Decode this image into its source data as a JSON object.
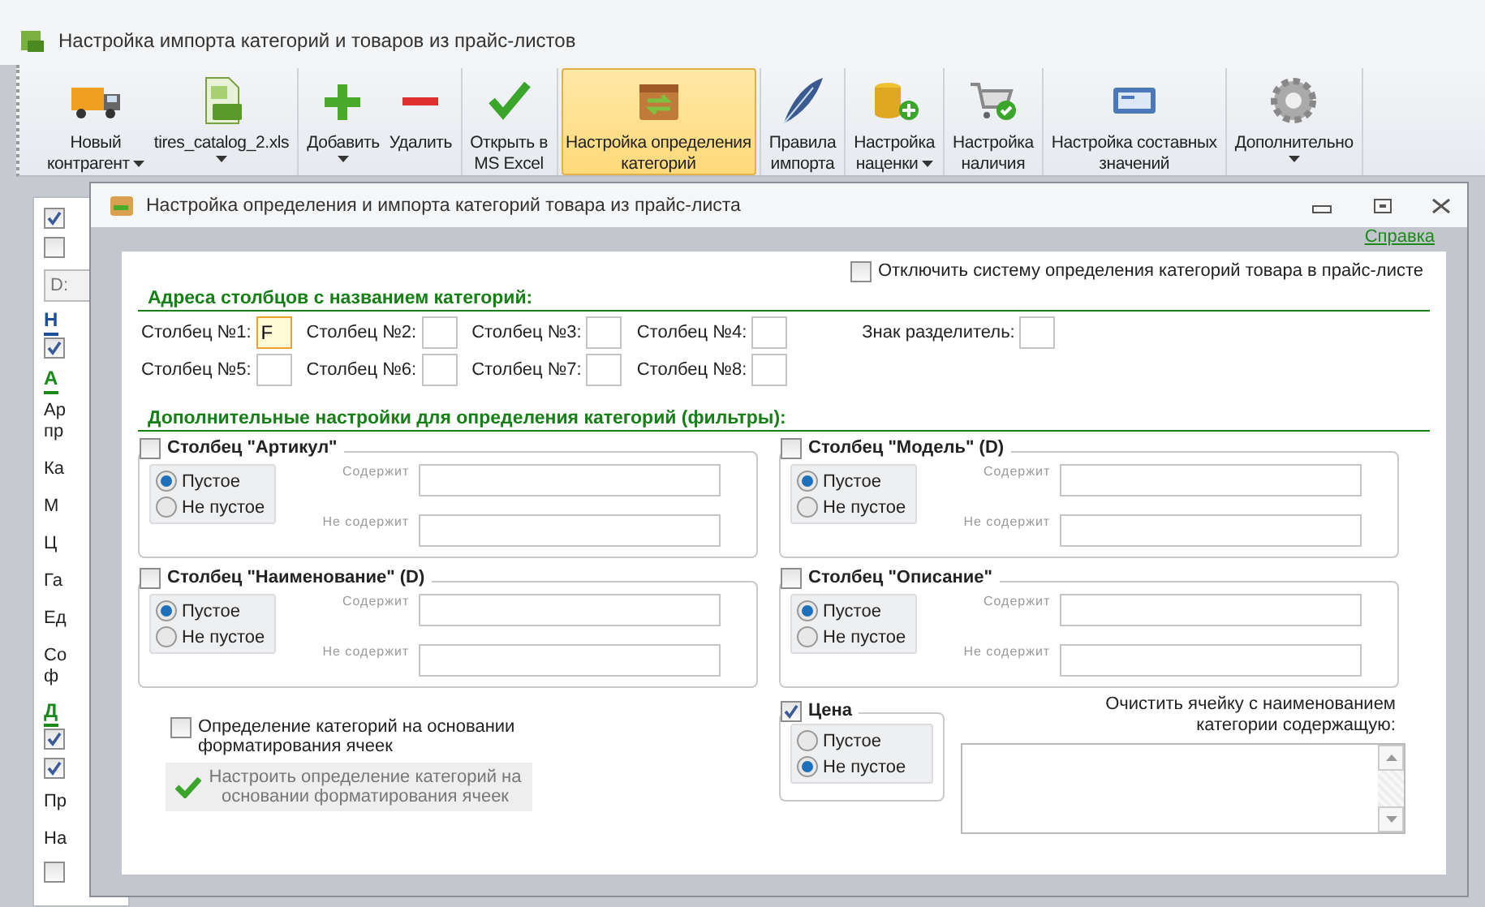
{
  "window": {
    "title": "Настройка импорта категорий и товаров из прайс-листов"
  },
  "toolbar": {
    "groups": [
      [
        {
          "label": "Новый\nконтрагент",
          "kind": "truck",
          "dropdown": true,
          "selected": false
        },
        {
          "label": "tires_catalog_2.xls",
          "kind": "xls",
          "dropdown": true,
          "selected": false
        }
      ],
      [
        {
          "label": "Добавить",
          "kind": "plus",
          "dropdown": true,
          "selected": false
        },
        {
          "label": "Удалить",
          "kind": "minus",
          "dropdown": false,
          "selected": false
        }
      ],
      [
        {
          "label": "Открыть в\nMS Excel",
          "kind": "check",
          "dropdown": false,
          "selected": false
        }
      ],
      [
        {
          "label": "Настройка определения\nкатегорий",
          "kind": "box",
          "dropdown": false,
          "selected": true
        }
      ],
      [
        {
          "label": "Правила\nимпорта",
          "kind": "feather",
          "dropdown": false,
          "selected": false
        }
      ],
      [
        {
          "label": "Настройка\nнаценки",
          "kind": "coins",
          "dropdown": true,
          "selected": false
        }
      ],
      [
        {
          "label": "Настройка\nналичия",
          "kind": "cart",
          "dropdown": false,
          "selected": false
        }
      ],
      [
        {
          "label": "Настройка составных\nзначений",
          "kind": "card",
          "dropdown": false,
          "selected": false
        }
      ],
      [
        {
          "label": "Дополнительно",
          "kind": "gear",
          "dropdown": true,
          "selected": false
        }
      ]
    ]
  },
  "background_panel": {
    "items": [
      {
        "kind": "checkbox",
        "checked": true
      },
      {
        "kind": "checkbox",
        "checked": false
      },
      {
        "kind": "field",
        "value": "D:"
      },
      {
        "kind": "heading",
        "text": "Н",
        "color": "#1f4e9a"
      },
      {
        "kind": "checkbox",
        "checked": true
      },
      {
        "kind": "heading",
        "text": "А",
        "color": "#1a8a1a"
      },
      {
        "kind": "text",
        "text": "Ар\nпр"
      },
      {
        "kind": "text",
        "text": "Ка"
      },
      {
        "kind": "text",
        "text": "М"
      },
      {
        "kind": "text",
        "text": "Ц"
      },
      {
        "kind": "text",
        "text": "Га"
      },
      {
        "kind": "text",
        "text": "Ед"
      },
      {
        "kind": "text",
        "text": "Со\nф"
      },
      {
        "kind": "heading",
        "text": "Д",
        "color": "#1a8a1a"
      },
      {
        "kind": "checkbox",
        "checked": true
      },
      {
        "kind": "checkbox",
        "checked": true
      },
      {
        "kind": "text",
        "text": "Пр"
      },
      {
        "kind": "text",
        "text": "На"
      },
      {
        "kind": "checkbox",
        "checked": false
      }
    ]
  },
  "dialog": {
    "title": "Настройка определения и импорта категорий товара из прайс-листа",
    "help_link": "Справка",
    "disable_option": {
      "label": "Отключить систему определения категорий товара в прайс-листе",
      "checked": false
    },
    "columns_heading": "Адреса столбцов с названием категорий:",
    "columns": [
      {
        "label": "Столбец №1:",
        "value": "F",
        "focused": true
      },
      {
        "label": "Столбец №2:",
        "focused": false
      },
      {
        "label": "Столбец №3:",
        "focused": false
      },
      {
        "label": "Столбец №4:",
        "focused": false
      },
      {
        "label": "Столбец №5:",
        "focused": false
      },
      {
        "label": "Столбец №6:",
        "focused": false
      },
      {
        "label": "Столбец №7:",
        "focused": false
      },
      {
        "label": "Столбец №8:",
        "focused": false
      }
    ],
    "separator": {
      "label": "Знак разделитель:"
    },
    "filters_heading": "Дополнительные настройки для определения категорий (фильтры):",
    "filters": [
      {
        "title": "Столбец \"Артикул\"",
        "checked": false,
        "options": [
          {
            "label": "Пустое",
            "selected": true
          },
          {
            "label": "Не пустое",
            "selected": false
          }
        ],
        "fields": [
          {
            "label": "Содержит"
          },
          {
            "label": "Не содержит"
          }
        ]
      },
      {
        "title": "Столбец \"Модель\" (D)",
        "checked": false,
        "options": [
          {
            "label": "Пустое",
            "selected": true
          },
          {
            "label": "Не пустое",
            "selected": false
          }
        ],
        "fields": [
          {
            "label": "Содержит"
          },
          {
            "label": "Не содержит"
          }
        ]
      },
      {
        "title": "Столбец \"Наименование\" (D)",
        "checked": false,
        "options": [
          {
            "label": "Пустое",
            "selected": true
          },
          {
            "label": "Не пустое",
            "selected": false
          }
        ],
        "fields": [
          {
            "label": "Содержит"
          },
          {
            "label": "Не содержит"
          }
        ]
      },
      {
        "title": "Столбец \"Описание\"",
        "checked": false,
        "options": [
          {
            "label": "Пустое",
            "selected": true
          },
          {
            "label": "Не пустое",
            "selected": false
          }
        ],
        "fields": [
          {
            "label": "Содержит"
          },
          {
            "label": "Не содержит"
          }
        ]
      }
    ],
    "format_option": {
      "label": "Определение категорий на основании форматирования ячеек",
      "checked": false
    },
    "format_button": {
      "label": "Настроить определение категорий на основании форматирования ячеек",
      "disabled": true
    },
    "price": {
      "title": "Цена",
      "checked": true,
      "options": [
        {
          "label": "Пустое",
          "selected": false
        },
        {
          "label": "Не пустое",
          "selected": true
        }
      ]
    },
    "clear_label": "Очистить ячейку с наименованием категории содержащую:"
  }
}
